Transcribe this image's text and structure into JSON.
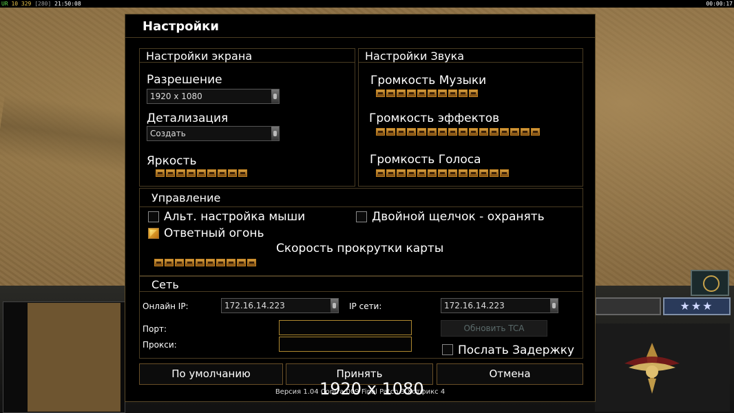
{
  "hud": {
    "left_prefix": "UR",
    "left_val1": "10 329",
    "left_val2": "[280]",
    "left_time": "21:50:08",
    "right_time": "00:00:17"
  },
  "dialog": {
    "title": "Настройки",
    "screen": {
      "heading": "Настройки экрана",
      "resolution_label": "Разрешение",
      "resolution_value": "1920 x 1080",
      "detail_label": "Детализация",
      "detail_value": "Создать",
      "brightness_label": "Яркость",
      "brightness_level": 9
    },
    "sound": {
      "heading": "Настройки Звука",
      "music_label": "Громкость Музыки",
      "music_level": 10,
      "effects_label": "Громкость эффектов",
      "effects_level": 16,
      "voice_label": "Громкость Голоса",
      "voice_level": 13
    },
    "controls": {
      "heading": "Управление",
      "alt_mouse_label": "Альт. настройка мыши",
      "alt_mouse_checked": false,
      "double_click_label": "Двойной щелчок - охранять",
      "double_click_checked": false,
      "return_fire_label": "Ответный огонь",
      "return_fire_checked": true,
      "scroll_speed_label": "Скорость прокрутки карты",
      "scroll_speed_level": 10
    },
    "network": {
      "heading": "Сеть",
      "online_ip_label": "Онлайн IP:",
      "online_ip_value": "172.16.14.223",
      "lan_ip_label": "IP сети:",
      "lan_ip_value": "172.16.14.223",
      "port_label": "Порт:",
      "port_value": "",
      "proxy_label": "Прокси:",
      "proxy_value": "",
      "update_tca_label": "Обновить TCA",
      "send_delay_label": "Послать Задержку",
      "send_delay_checked": false
    },
    "buttons": {
      "default": "По умолчанию",
      "accept": "Принять",
      "cancel": "Отмена"
    },
    "version": "Версия 1.04 Contra 009 Final Patch 3 Хотфикс 4",
    "overlay_resolution": "1920 x 1080"
  },
  "colors": {
    "dialog_bg": "#000000",
    "border": "#4a3c22",
    "slider": "#c08020"
  }
}
